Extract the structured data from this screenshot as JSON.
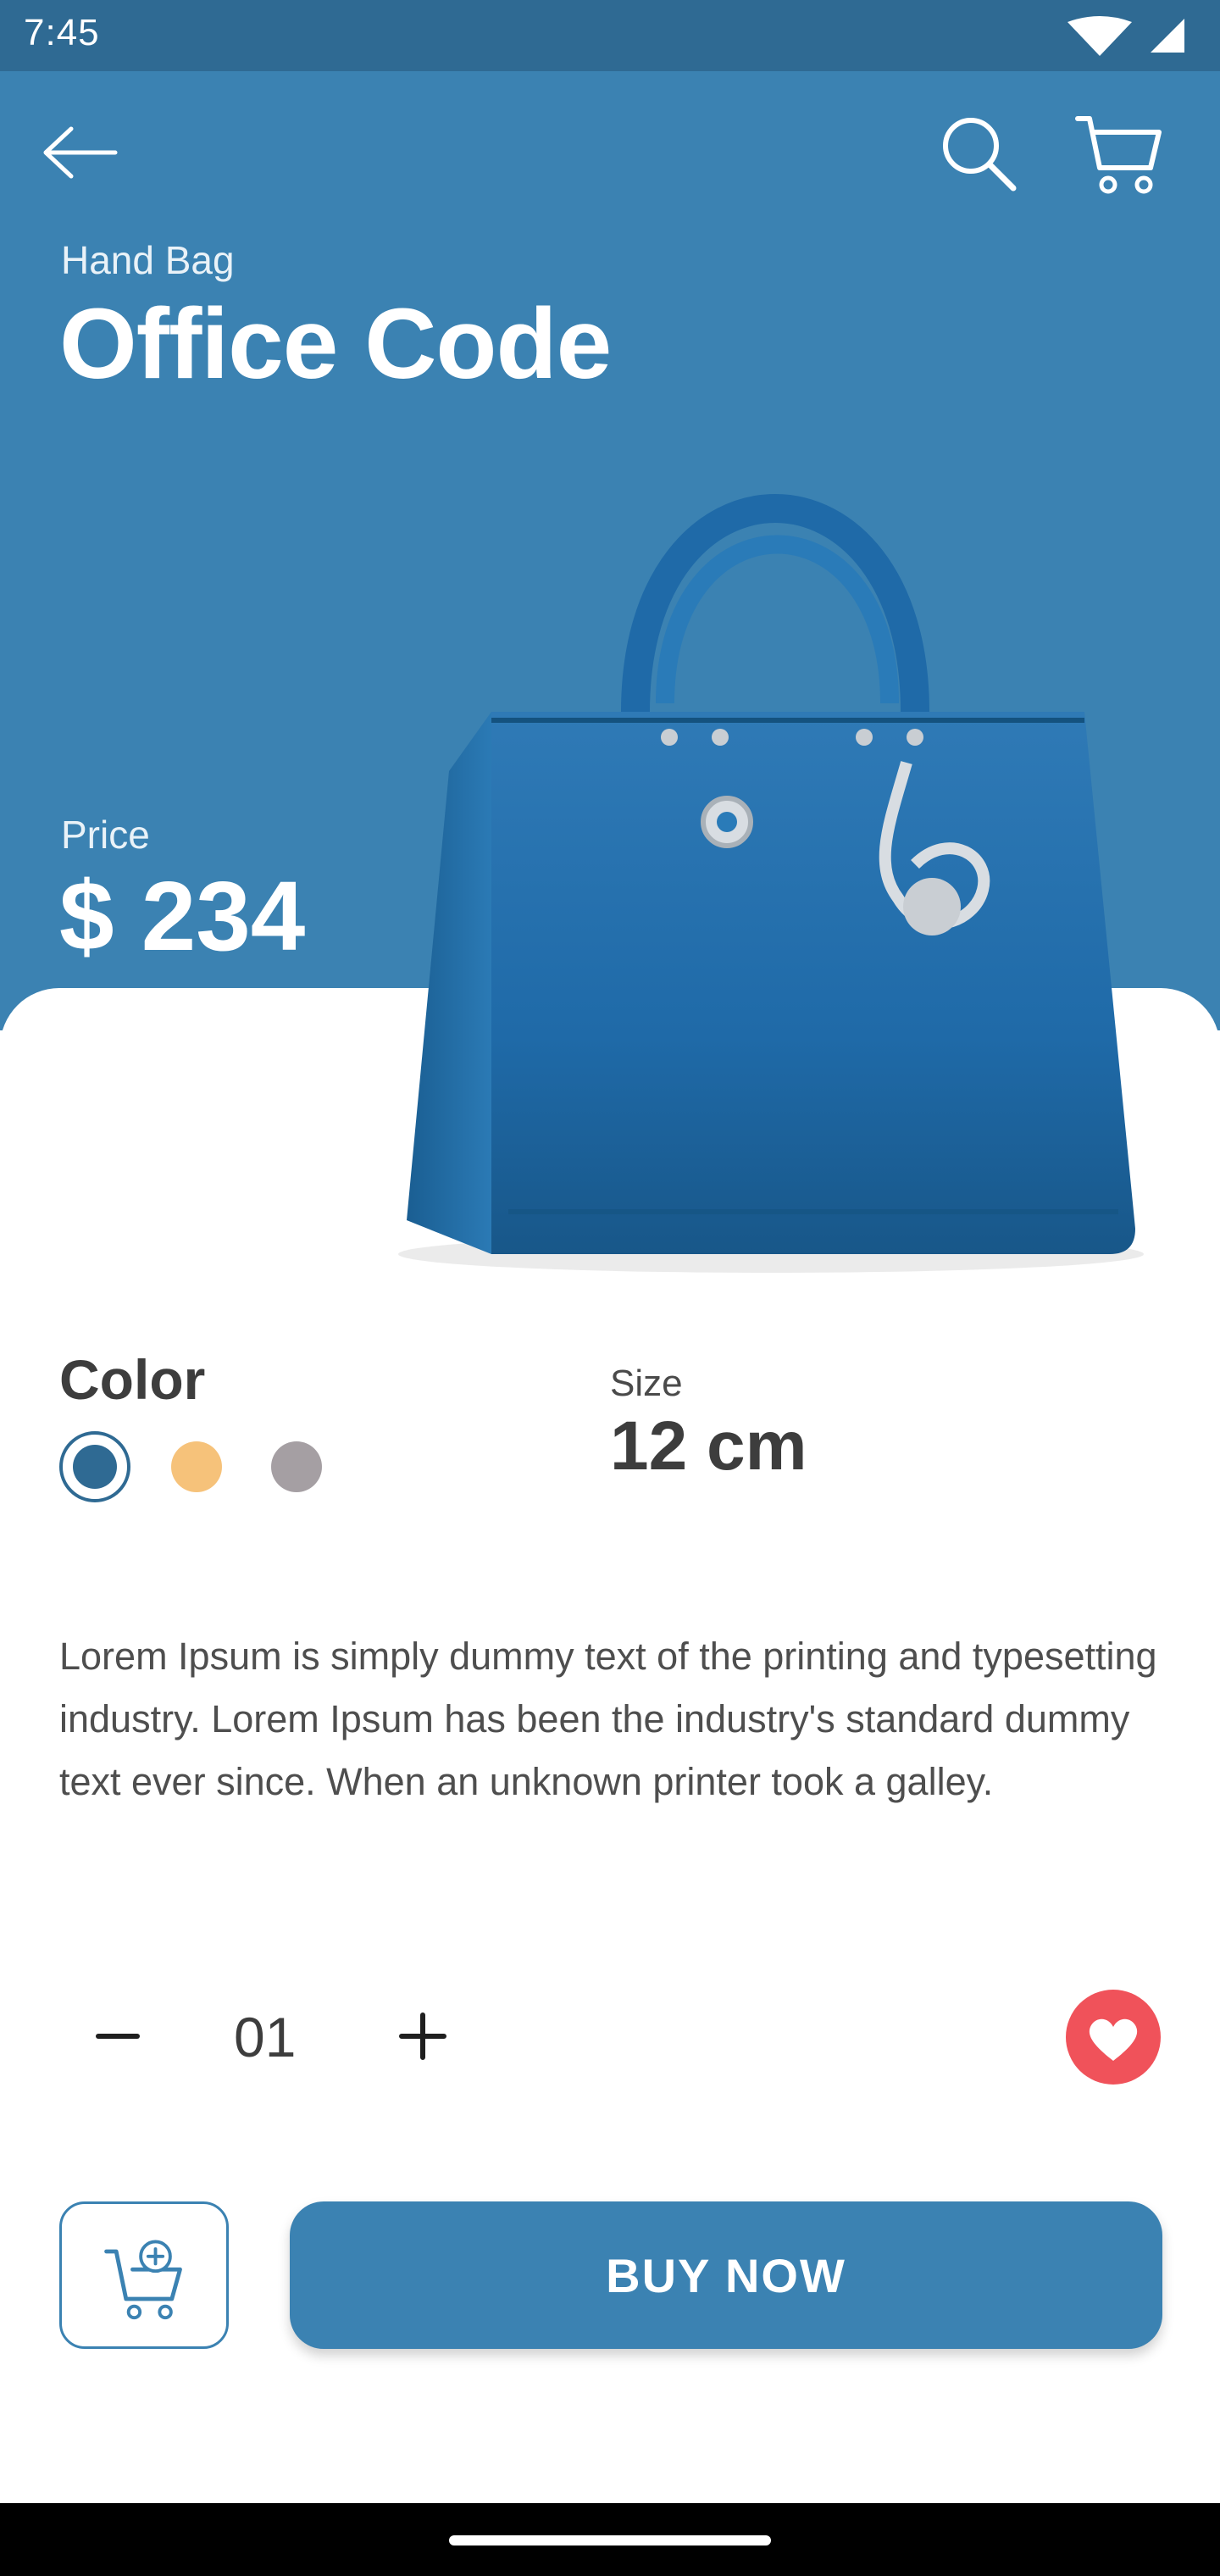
{
  "status_bar": {
    "time": "7:45"
  },
  "header": {
    "back_icon": "arrow-left-icon",
    "search_icon": "search-icon",
    "cart_icon": "cart-icon"
  },
  "product": {
    "category": "Hand Bag",
    "name": "Office Code",
    "price_label": "Price",
    "price": "$ 234",
    "color_label": "Color",
    "colors": [
      "#2f6a93",
      "#f6c27a",
      "#a59fa3"
    ],
    "selected_color_index": 0,
    "size_label": "Size",
    "size_value": "12 cm",
    "description": "Lorem Ipsum is simply dummy text of the printing and typesetting industry. Lorem Ipsum has been the industry's standard dummy text ever since. When an unknown printer took a galley."
  },
  "quantity": {
    "value": "01",
    "minus_icon": "minus-icon",
    "plus_icon": "plus-icon"
  },
  "actions": {
    "favorite_icon": "heart-icon",
    "add_to_cart_icon": "cart-add-icon",
    "buy_label": "BUY  NOW"
  },
  "theme": {
    "primary": "#3b82b2",
    "status_bar": "#2f6a93",
    "favorite": "#f0525a"
  }
}
